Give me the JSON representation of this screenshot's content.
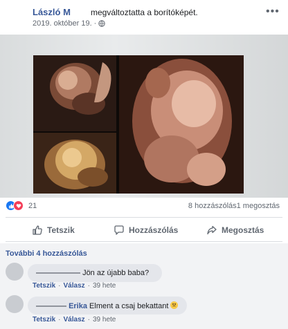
{
  "post": {
    "author": "László M",
    "action_text": "megváltoztatta a borítóképét.",
    "date": "2019. október 19.",
    "privacy_icon": "globe-icon",
    "more_icon": "more-options-icon"
  },
  "stats": {
    "reaction_icons": [
      "like-icon",
      "love-icon"
    ],
    "reaction_count": "21",
    "comments_shares": "8 hozzászólás1 megosztás"
  },
  "actions": {
    "like_label": "Tetszik",
    "comment_label": "Hozzászólás",
    "share_label": "Megosztás"
  },
  "comments": {
    "more_link": "További 4 hozzászólás",
    "items": [
      {
        "name": "",
        "text": "Jön az újabb baba?",
        "like": "Tetszik",
        "reply": "Válasz",
        "time": "39 hete"
      },
      {
        "name": "Erika",
        "text": "Elment a csaj bekattant",
        "like": "Tetszik",
        "reply": "Válasz",
        "time": "39 hete"
      }
    ]
  },
  "colors": {
    "link_blue": "#385898",
    "like_blue": "#1877f2",
    "love_red": "#f33e58",
    "comment_bg": "#f2f3f5"
  }
}
